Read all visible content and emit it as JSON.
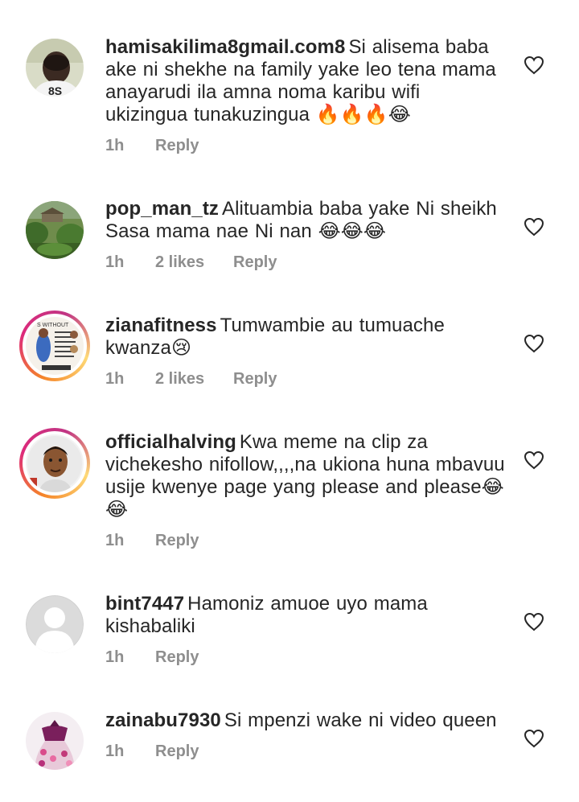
{
  "comments": [
    {
      "username": "hamisakilima8gmail.com8",
      "text": "Si alisema baba ake ni shekhe na  family yake leo tena mama anayarudi ila amna noma karibu wifi ukizingua tunakuzingua 🔥🔥🔥😂",
      "time": "1h",
      "likes": "",
      "reply": "Reply",
      "has_story_ring": false
    },
    {
      "username": "pop_man_tz",
      "text": "Alituambia baba yake Ni sheikh Sasa mama nae Ni nan 😂😂😂",
      "time": "1h",
      "likes": "2 likes",
      "reply": "Reply",
      "has_story_ring": false
    },
    {
      "username": "zianafitness",
      "text": "Tumwambie au tumuache kwanza😢",
      "time": "1h",
      "likes": "2 likes",
      "reply": "Reply",
      "has_story_ring": true
    },
    {
      "username": "officialhalving",
      "text": "Kwa meme na clip za vichekesho nifollow,,,,na ukiona huna mbavuu usije kwenye page yang please and please😂😂",
      "time": "1h",
      "likes": "",
      "reply": "Reply",
      "has_story_ring": true
    },
    {
      "username": "bint7447",
      "text": "Hamoniz amuoe uyo mama kishabaliki",
      "time": "1h",
      "likes": "",
      "reply": "Reply",
      "has_story_ring": false
    },
    {
      "username": "zainabu7930",
      "text": "Si mpenzi wake ni video queen",
      "time": "1h",
      "likes": "",
      "reply": "Reply",
      "has_story_ring": false
    }
  ],
  "colors": {
    "text": "#262626",
    "meta": "#8e8e8e"
  }
}
